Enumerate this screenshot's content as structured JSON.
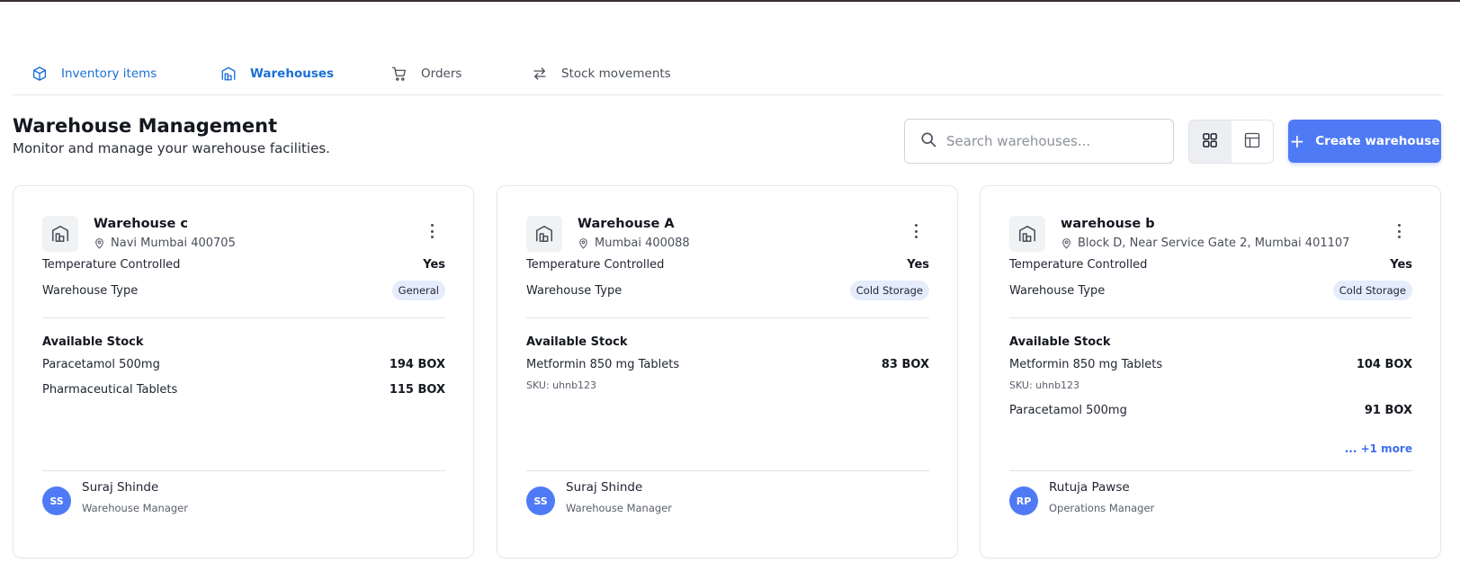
{
  "tabs": [
    {
      "label": "Inventory items",
      "icon": "box-icon"
    },
    {
      "label": "Warehouses",
      "icon": "warehouse-icon"
    },
    {
      "label": "Orders",
      "icon": "cart-icon"
    },
    {
      "label": "Stock movements",
      "icon": "swap-arrows-icon"
    }
  ],
  "header": {
    "title": "Warehouse Management",
    "subtitle": "Monitor and manage your warehouse facilities."
  },
  "search": {
    "placeholder": "Search warehouses..."
  },
  "create_button": {
    "label": "Create warehouse"
  },
  "labels": {
    "temperature": "Temperature Controlled",
    "type": "Warehouse Type",
    "available_stock": "Available Stock"
  },
  "colors": {
    "accent": "#4f7af6",
    "active_tab": "#1a6fd6",
    "badge_bg": "#e5ecfb"
  },
  "warehouses": [
    {
      "name": "Warehouse c",
      "location": "Navi Mumbai 400705",
      "temperature_controlled": "Yes",
      "type": "General",
      "stock": [
        {
          "name": "Paracetamol 500mg",
          "qty": "194 BOX"
        },
        {
          "name": "Pharmaceutical Tablets",
          "qty": "115 BOX"
        }
      ],
      "manager": {
        "initials": "SS",
        "name": "Suraj Shinde",
        "role": "Warehouse Manager"
      }
    },
    {
      "name": "Warehouse A",
      "location": "Mumbai 400088",
      "temperature_controlled": "Yes",
      "type": "Cold Storage",
      "stock": [
        {
          "name": "Metformin 850 mg Tablets",
          "qty": "83 BOX",
          "sku": "SKU: uhnb123"
        }
      ],
      "manager": {
        "initials": "SS",
        "name": "Suraj Shinde",
        "role": "Warehouse Manager"
      }
    },
    {
      "name": "warehouse b",
      "location": "Block D, Near Service Gate 2, Mumbai 401107",
      "temperature_controlled": "Yes",
      "type": "Cold Storage",
      "stock": [
        {
          "name": "Metformin 850 mg Tablets",
          "qty": "104 BOX",
          "sku": "SKU: uhnb123"
        },
        {
          "name": "Paracetamol 500mg",
          "qty": "91 BOX"
        }
      ],
      "more": "... +1 more",
      "manager": {
        "initials": "RP",
        "name": "Rutuja Pawse",
        "role": "Operations Manager"
      }
    }
  ]
}
